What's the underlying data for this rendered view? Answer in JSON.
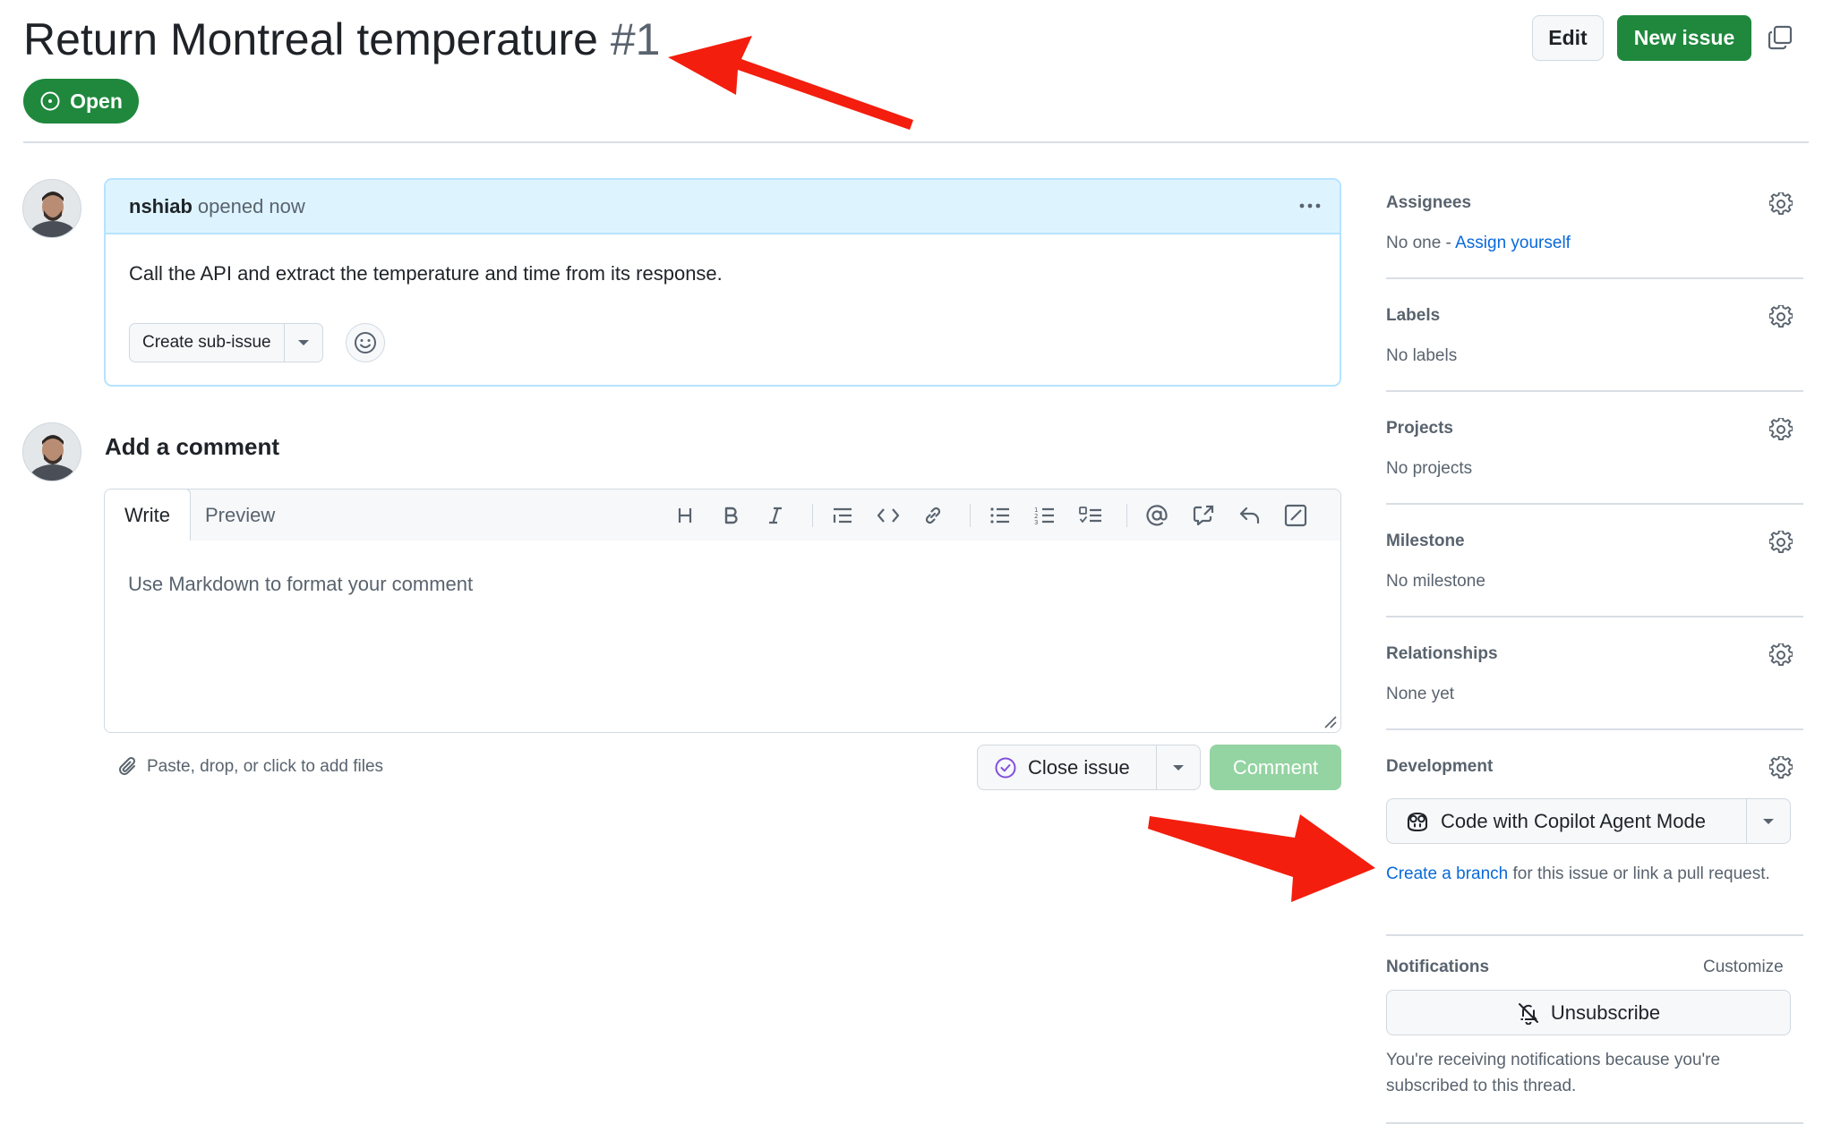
{
  "issue": {
    "title": "Return Montreal temperature",
    "number": "#1",
    "state": "Open"
  },
  "header": {
    "edit_label": "Edit",
    "new_issue_label": "New issue"
  },
  "body": {
    "author": "nshiab",
    "opened": "opened now",
    "text": "Call the API and extract the temperature and time from its response.",
    "create_subissue_label": "Create sub-issue"
  },
  "comment": {
    "heading": "Add a comment",
    "tab_write": "Write",
    "tab_preview": "Preview",
    "placeholder": "Use Markdown to format your comment",
    "attach_text": "Paste, drop, or click to add files",
    "close_issue_label": "Close issue",
    "comment_label": "Comment"
  },
  "sidebar": {
    "assignees": {
      "heading": "Assignees",
      "value_prefix": "No one - ",
      "link": "Assign yourself"
    },
    "labels": {
      "heading": "Labels",
      "value": "No labels"
    },
    "projects": {
      "heading": "Projects",
      "value": "No projects"
    },
    "milestone": {
      "heading": "Milestone",
      "value": "No milestone"
    },
    "relationships": {
      "heading": "Relationships",
      "value": "None yet"
    },
    "development": {
      "heading": "Development",
      "copilot_label": "Code with Copilot Agent Mode",
      "branch_link": "Create a branch",
      "branch_rest": " for this issue or link a pull request."
    },
    "notifications": {
      "heading": "Notifications",
      "customize": "Customize",
      "unsubscribe_label": "Unsubscribe",
      "info": "You're receiving notifications because you're subscribed to this thread."
    }
  },
  "colors": {
    "open_green": "#1f883d",
    "link_blue": "#0969da",
    "annotation_red": "#f31e0e",
    "header_blue": "#ddf4ff"
  }
}
